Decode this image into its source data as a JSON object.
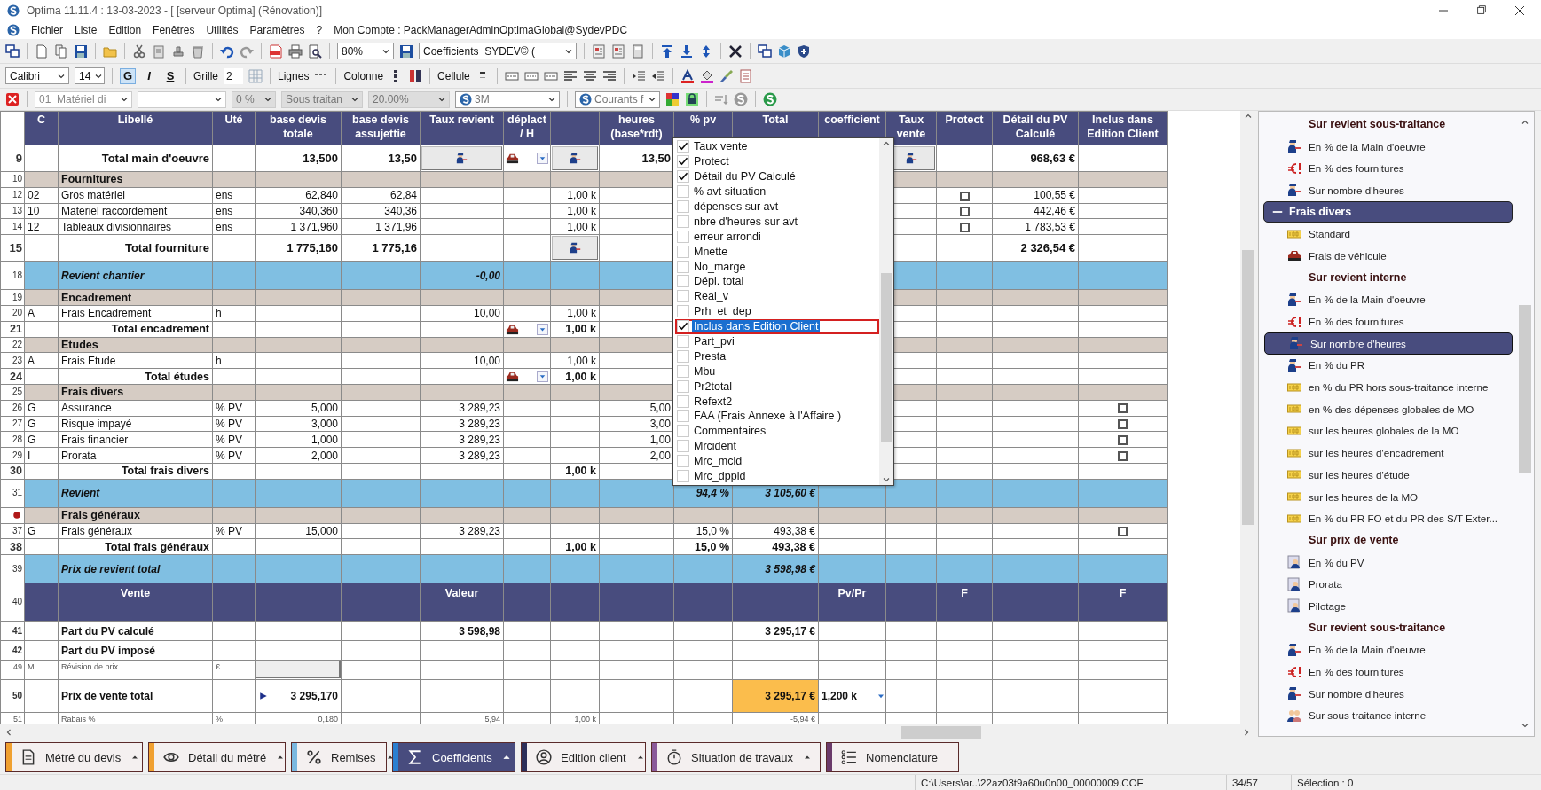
{
  "window": {
    "title": "Optima 11.11.4 : 13-03-2023 - [ [serveur Optima] (Rénovation)]"
  },
  "menu": {
    "items": [
      "Fichier",
      "Liste",
      "Edition",
      "Fenêtres",
      "Utilités",
      "Paramètres",
      "?"
    ],
    "account": "Mon Compte : PackManagerAdminOptimaGlobal@SydevPDC"
  },
  "toolbar": {
    "zoom": "80%",
    "view": "Coefficients  SYDEV© ("
  },
  "format_bar": {
    "font": "Calibri",
    "size": "14",
    "grid_label": "Grille",
    "grid_value": "2",
    "lines_label": "Lignes",
    "column_label": "Colonne",
    "cell_label": "Cellule",
    "style_buttons": [
      {
        "label": "G",
        "selected": true
      },
      {
        "label": "I",
        "selected": false
      },
      {
        "label": "S",
        "selected": false
      }
    ]
  },
  "filter_bar": {
    "combos": [
      {
        "kind": "plain",
        "value": "01  Matériel di"
      },
      {
        "kind": "plain"
      },
      {
        "kind": "shaded",
        "value": "0 %"
      },
      {
        "kind": "shaded",
        "value": "Sous traitan"
      },
      {
        "kind": "shaded",
        "value": "20.00%"
      },
      {
        "kind": "logo",
        "value": "3M"
      },
      {
        "kind": "logo",
        "value": "Courants f"
      }
    ]
  },
  "sheet": {
    "columns": [
      "C",
      "Libellé",
      "Uté",
      "base devis totale",
      "base devis assujettie",
      "Taux revient",
      "déplact / H",
      null,
      "heures (base*rdt)",
      "% pv",
      "Total",
      "coefficient",
      "Taux vente",
      "Protect",
      "Détail du PV Calculé",
      "Inclus dans Edition Client"
    ],
    "rows": [
      {
        "num": "9",
        "kind": "total",
        "cells": [
          null,
          "Total main d'oeuvre",
          null,
          "13,500",
          "13,50",
          {
            "kind": "icon-button"
          },
          {
            "kind": "vehicle-dropdown"
          },
          {
            "kind": "icon-button"
          },
          "13,50",
          null,
          null,
          null,
          {
            "kind": "icon-button"
          },
          null,
          "968,63 €"
        ]
      },
      {
        "num": "10",
        "kind": "section",
        "cells": [
          null,
          "Fournitures"
        ]
      },
      {
        "num": "12",
        "kind": "item",
        "cells": [
          "02",
          "Gros matériel",
          "ens",
          "62,840",
          "62,84",
          null,
          null,
          "1,00 k",
          null,
          null,
          null,
          null,
          null,
          {
            "kind": "checkbox",
            "checked": false
          },
          "100,55 €"
        ]
      },
      {
        "num": "13",
        "kind": "item",
        "cells": [
          "10",
          "Materiel raccordement",
          "ens",
          "340,360",
          "340,36",
          null,
          null,
          "1,00 k",
          null,
          null,
          null,
          null,
          null,
          {
            "kind": "checkbox",
            "checked": false
          },
          "442,46 €"
        ]
      },
      {
        "num": "14",
        "kind": "item",
        "cells": [
          "12",
          "Tableaux divisionnaires",
          "ens",
          "1 371,960",
          "1 371,96",
          null,
          null,
          "1,00 k",
          null,
          null,
          null,
          null,
          null,
          {
            "kind": "checkbox",
            "checked": false
          },
          "1 783,53 €"
        ]
      },
      {
        "num": "15",
        "kind": "total",
        "cells": [
          null,
          "Total fourniture",
          null,
          "1 775,160",
          "1 775,16",
          null,
          null,
          {
            "kind": "icon-button"
          },
          null,
          null,
          null,
          null,
          null,
          null,
          "2 326,54 €"
        ]
      },
      {
        "num": "18",
        "kind": "summary",
        "cells": [
          null,
          "Revient chantier",
          null,
          null,
          null,
          "-0,00"
        ]
      },
      {
        "num": "19",
        "kind": "section",
        "cells": [
          null,
          "Encadrement"
        ]
      },
      {
        "num": "20",
        "kind": "item",
        "cells": [
          "A",
          "Frais Encadrement",
          "h",
          null,
          null,
          "10,00",
          null,
          "1,00 k"
        ]
      },
      {
        "num": "21",
        "kind": "subtotal",
        "cells": [
          null,
          "Total encadrement",
          null,
          null,
          null,
          null,
          {
            "kind": "vehicle-dropdown"
          },
          "1,00 k"
        ]
      },
      {
        "num": "22",
        "kind": "section",
        "cells": [
          null,
          "Etudes"
        ]
      },
      {
        "num": "23",
        "kind": "item",
        "cells": [
          "A",
          "Frais Etude",
          "h",
          null,
          null,
          "10,00",
          null,
          "1,00 k"
        ]
      },
      {
        "num": "24",
        "kind": "subtotal",
        "cells": [
          null,
          "Total études",
          null,
          null,
          null,
          null,
          {
            "kind": "vehicle-dropdown"
          },
          "1,00 k"
        ]
      },
      {
        "num": "25",
        "kind": "section",
        "cells": [
          null,
          "Frais divers"
        ]
      },
      {
        "num": "26",
        "kind": "item",
        "cells": [
          "G",
          "Assurance",
          "% PV",
          "5,000",
          null,
          "3 289,23",
          null,
          null,
          "5,00",
          null,
          null,
          null,
          null,
          null,
          null,
          {
            "kind": "checkbox",
            "checked": false
          }
        ]
      },
      {
        "num": "27",
        "kind": "item",
        "cells": [
          "G",
          "Risque impayé",
          "% PV",
          "3,000",
          null,
          "3 289,23",
          null,
          null,
          "3,00",
          null,
          null,
          null,
          null,
          null,
          null,
          {
            "kind": "checkbox",
            "checked": false
          }
        ]
      },
      {
        "num": "28",
        "kind": "item",
        "cells": [
          "G",
          "Frais financier",
          "% PV",
          "1,000",
          null,
          "3 289,23",
          null,
          null,
          "1,00",
          null,
          null,
          null,
          null,
          null,
          null,
          {
            "kind": "checkbox",
            "checked": false
          }
        ]
      },
      {
        "num": "29",
        "kind": "item",
        "cells": [
          "I",
          "Prorata",
          "% PV",
          "2,000",
          null,
          "3 289,23",
          null,
          null,
          "2,00",
          null,
          null,
          null,
          null,
          null,
          null,
          {
            "kind": "checkbox",
            "checked": false
          }
        ]
      },
      {
        "num": "30",
        "kind": "subtotal",
        "cells": [
          null,
          "Total frais divers",
          null,
          null,
          null,
          null,
          null,
          "1,00 k"
        ]
      },
      {
        "num": "31",
        "kind": "summary",
        "cells": [
          null,
          "Revient",
          null,
          null,
          null,
          null,
          null,
          null,
          null,
          "94,4 %",
          "3 105,60 €"
        ]
      },
      {
        "kind": "section",
        "bookmarked": true,
        "cells": [
          null,
          "Frais généraux"
        ]
      },
      {
        "num": "37",
        "kind": "item",
        "cells": [
          "G",
          "Frais généraux",
          "% PV",
          "15,000",
          null,
          "3 289,23",
          null,
          null,
          null,
          "15,0 %",
          "493,38 €",
          null,
          null,
          null,
          null,
          {
            "kind": "checkbox",
            "checked": false
          }
        ]
      },
      {
        "num": "38",
        "kind": "subtotal",
        "cells": [
          null,
          "Total frais généraux",
          null,
          null,
          null,
          null,
          null,
          "1,00 k",
          null,
          "15,0 %",
          "493,38 €"
        ]
      },
      {
        "num": "39",
        "kind": "summary",
        "cells": [
          null,
          "Prix de revient total",
          null,
          null,
          null,
          null,
          null,
          null,
          null,
          null,
          "3 598,98 €"
        ]
      },
      {
        "num": "40",
        "kind": "band",
        "cells": [
          null,
          "Vente",
          null,
          null,
          null,
          "Valeur",
          null,
          null,
          null,
          null,
          null,
          "Pv/Pr",
          null,
          "F",
          null,
          "F"
        ]
      },
      {
        "num": "41",
        "kind": "plain",
        "cells": [
          null,
          "Part du PV calculé",
          null,
          null,
          null,
          "3 598,98",
          null,
          null,
          null,
          null,
          "3 295,17 €"
        ]
      },
      {
        "num": "42",
        "kind": "plain",
        "cells": [
          null,
          "Part du PV imposé"
        ]
      },
      {
        "num": "49",
        "kind": "small",
        "cells": [
          "M",
          "Révision de prix",
          "€",
          {
            "kind": "field"
          }
        ]
      },
      {
        "num": "50",
        "kind": "big",
        "cells": [
          null,
          "Prix de vente total",
          null,
          {
            "kind": "pointer-value",
            "text": "3 295,170"
          },
          null,
          null,
          null,
          null,
          null,
          null,
          {
            "kind": "highlight",
            "text": "3 295,17 €"
          },
          {
            "kind": "dropdown-value",
            "text": "1,200 k"
          }
        ]
      },
      {
        "num": "51",
        "kind": "small",
        "cells": [
          null,
          "Rabais %",
          "%",
          "0,180",
          null,
          "5,94",
          null,
          "1,00 k",
          null,
          null,
          "-5,94 €"
        ]
      }
    ]
  },
  "column_menu": {
    "items": [
      {
        "label": "Taux vente",
        "checked": true,
        "selected": false
      },
      {
        "label": "Protect",
        "checked": true,
        "selected": false
      },
      {
        "label": "Détail du PV Calculé",
        "checked": true,
        "selected": false
      },
      {
        "label": "% avt situation",
        "checked": false,
        "selected": false
      },
      {
        "label": "dépenses sur avt",
        "checked": false,
        "selected": false
      },
      {
        "label": "nbre d'heures sur avt",
        "checked": false,
        "selected": false
      },
      {
        "label": "erreur arrondi",
        "checked": false,
        "selected": false
      },
      {
        "label": "Mnette",
        "checked": false,
        "selected": false
      },
      {
        "label": "No_marge",
        "checked": false,
        "selected": false
      },
      {
        "label": "Dépl. total",
        "checked": false,
        "selected": false
      },
      {
        "label": "Real_v",
        "checked": false,
        "selected": false
      },
      {
        "label": "Prh_et_dep",
        "checked": false,
        "selected": false
      },
      {
        "label": "Inclus dans Edition Client",
        "checked": true,
        "selected": true
      },
      {
        "label": "Part_pvi",
        "checked": false,
        "selected": false
      },
      {
        "label": "Presta",
        "checked": false,
        "selected": false
      },
      {
        "label": "Mbu",
        "checked": false,
        "selected": false
      },
      {
        "label": "Pr2total",
        "checked": false,
        "selected": false
      },
      {
        "label": "Refext2",
        "checked": false,
        "selected": false
      },
      {
        "label": "FAA (Frais Annexe à l'Affaire )",
        "checked": false,
        "selected": false
      },
      {
        "label": "Commentaires",
        "checked": false,
        "selected": false
      },
      {
        "label": "Mrcident",
        "checked": false,
        "selected": false
      },
      {
        "label": "Mrc_mcid",
        "checked": false,
        "selected": false
      },
      {
        "label": "Mrc_dppid",
        "checked": false,
        "selected": false
      }
    ]
  },
  "panel": {
    "items": [
      {
        "kind": "heading",
        "label": "Sur revient sous-traitance"
      },
      {
        "kind": "labour",
        "label": "En % de la Main d'oeuvre",
        "selected": false
      },
      {
        "kind": "supplies",
        "label": "En % des fournitures",
        "selected": false
      },
      {
        "kind": "labour",
        "label": "Sur nombre d'heures",
        "selected": false
      },
      {
        "kind": "group",
        "label": "Frais divers",
        "expanded": true,
        "selected": false,
        "children": [
          {
            "kind": "flat",
            "label": "Standard",
            "selected": false
          },
          {
            "kind": "vehicle",
            "label": "Frais de véhicule",
            "selected": false
          },
          {
            "kind": "heading",
            "label": "Sur revient interne"
          },
          {
            "kind": "labour",
            "label": "En % de la Main d'oeuvre",
            "selected": false
          },
          {
            "kind": "supplies",
            "label": "En % des fournitures",
            "selected": false
          },
          {
            "kind": "labour",
            "label": "Sur nombre d'heures",
            "selected": true
          },
          {
            "kind": "labour",
            "label": "En % du PR",
            "selected": false
          },
          {
            "kind": "flat",
            "label": "en % du PR hors sous-traitance interne",
            "selected": false
          },
          {
            "kind": "flat",
            "label": "en % des dépenses globales de MO",
            "selected": false
          },
          {
            "kind": "flat",
            "label": "sur les heures globales de la MO",
            "selected": false
          },
          {
            "kind": "flat",
            "label": "sur les heures d'encadrement",
            "selected": false
          },
          {
            "kind": "flat",
            "label": "sur les heures d'étude",
            "selected": false
          },
          {
            "kind": "flat",
            "label": "sur les heures de la MO",
            "selected": false
          },
          {
            "kind": "flat",
            "label": "En % du PR FO et du PR des S/T Exter...",
            "selected": false
          },
          {
            "kind": "heading",
            "label": "Sur prix de vente"
          },
          {
            "kind": "sale",
            "label": "En % du PV",
            "selected": false
          },
          {
            "kind": "sale",
            "label": "Prorata",
            "selected": false
          },
          {
            "kind": "sale",
            "label": "Pilotage",
            "selected": false
          },
          {
            "kind": "heading",
            "label": "Sur revient sous-traitance"
          },
          {
            "kind": "labour",
            "label": "En % de la Main d'oeuvre",
            "selected": false
          },
          {
            "kind": "supplies",
            "label": "En % des fournitures",
            "selected": false
          },
          {
            "kind": "labour",
            "label": "Sur nombre d'heures",
            "selected": false
          },
          {
            "kind": "team",
            "label": "Sur sous traitance interne",
            "selected": false
          }
        ]
      }
    ]
  },
  "tabs": [
    {
      "label": "Métré du devis",
      "color": "#f0a030",
      "menu": true,
      "selected": false
    },
    {
      "label": "Détail du métré",
      "color": "#f0a030",
      "menu": true,
      "selected": false
    },
    {
      "label": "Remises",
      "color": "#7ab8e0",
      "menu": true,
      "selected": false
    },
    {
      "label": "Coefficients",
      "color": "#2a7fd0",
      "menu": true,
      "selected": true
    },
    {
      "label": "Edition client",
      "color": "#2c2f5a",
      "menu": true,
      "selected": false
    },
    {
      "label": "Situation de travaux",
      "color": "#8a5a9a",
      "menu": true,
      "selected": false
    },
    {
      "label": "Nomenclature",
      "color": "#6a3a6a",
      "menu": false,
      "selected": false
    }
  ],
  "status_bar": {
    "path": "C:\\Users\\ar..\\22az03t9a60u0n00_00000009.COF",
    "position": "34/57",
    "selection": "Sélection : 0"
  }
}
